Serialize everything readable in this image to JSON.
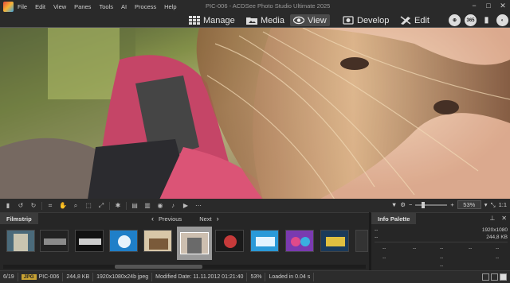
{
  "window": {
    "title": "PIC-006 - ACDSee Photo Studio Ultimate 2025",
    "menu": [
      "File",
      "Edit",
      "View",
      "Panes",
      "Tools",
      "AI",
      "Process",
      "Help"
    ],
    "controls": [
      "−",
      "□",
      "✕"
    ]
  },
  "modes": [
    {
      "label": "Manage",
      "icon": "grid-icon"
    },
    {
      "label": "Media",
      "icon": "folder-photo-icon"
    },
    {
      "label": "View",
      "icon": "eye-icon",
      "active": true
    },
    {
      "label": "Develop",
      "icon": "develop-icon"
    },
    {
      "label": "Edit",
      "icon": "brush-icon"
    }
  ],
  "mode_right_icons": [
    "globe-icon",
    "365-icon",
    "stats-icon",
    "dashboard-icon"
  ],
  "mode_right_labels": [
    "⊕",
    "365",
    "▮",
    "◐"
  ],
  "viewer": {
    "image_subject": "photo",
    "zoom": "53%",
    "fit_label": "1:1"
  },
  "filmstrip": {
    "title": "Filmstrip",
    "previous": "Previous",
    "next": "Next",
    "thumb_count": 13,
    "selected_index": 5
  },
  "info_palette": {
    "title": "Info Palette",
    "rows": [
      {
        "label": "--",
        "value": "1920x1080"
      },
      {
        "label": "--",
        "value": "244,8 KB"
      }
    ],
    "placeholder": "--"
  },
  "status": {
    "position": "6/19",
    "badge": "JPG",
    "filename": "PIC-006",
    "filesize": "244,8 KB",
    "fileinfo": "1920x1080x24b jpeg",
    "modified": "Modified Date: 11.11.2012 01:21:40",
    "zoom": "53%",
    "load": "Loaded in 0.04 s"
  },
  "colors": {
    "accent": "#c8a233",
    "background": "#1b1b1b",
    "panel": "#262626"
  }
}
